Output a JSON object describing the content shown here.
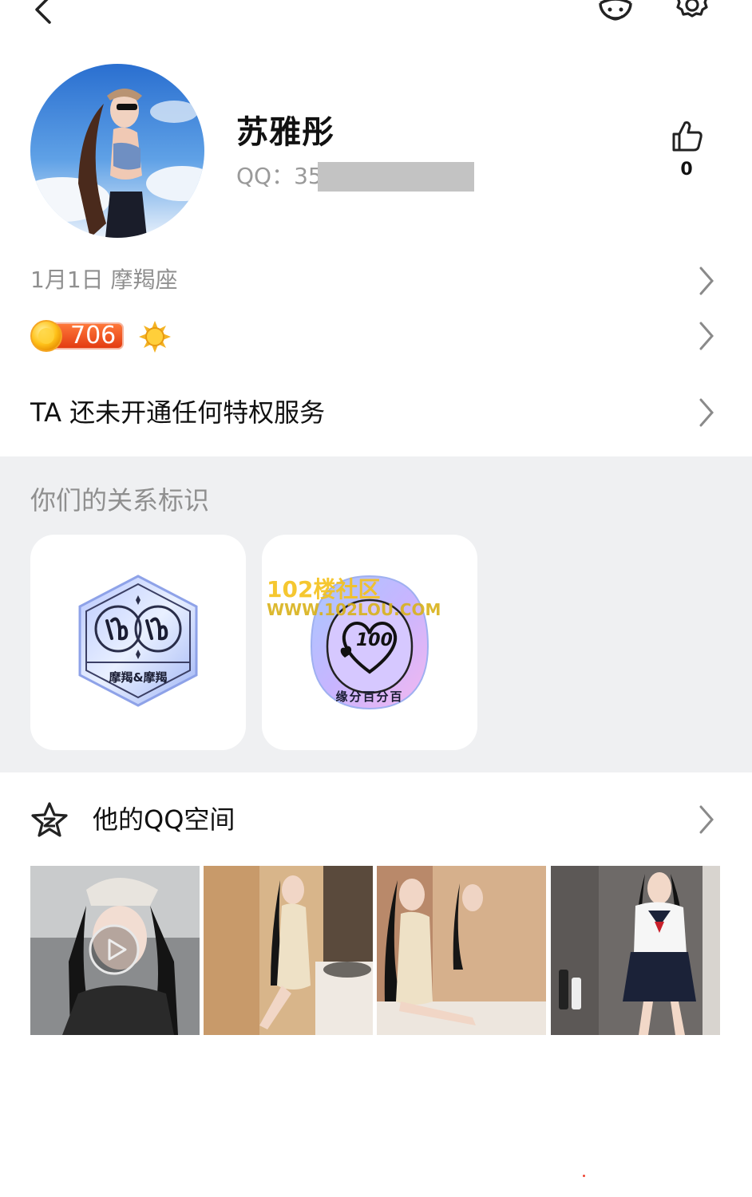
{
  "profile": {
    "name": "苏雅彤",
    "qq_label": "QQ：35",
    "like_count": "0"
  },
  "info": {
    "birthday": "1月1日  摩羯座",
    "level": "706",
    "privilege": "TA 还未开通任何特权服务"
  },
  "relationship": {
    "title": "你们的关系标识",
    "badges": [
      {
        "label": "摩羯&摩羯",
        "icon": "capricorn-badge-icon"
      },
      {
        "label": "缘分百分百",
        "score": "100",
        "icon": "heart-100-badge-icon"
      }
    ],
    "watermark_line1": "102楼社区",
    "watermark_line2": "WWW.102LOU.COM"
  },
  "qzone": {
    "title": "他的QQ空间",
    "photos": [
      {
        "kind": "video",
        "icon": "play-icon"
      },
      {
        "kind": "image"
      },
      {
        "kind": "image"
      },
      {
        "kind": "image"
      }
    ]
  },
  "icons": {
    "back": "back-arrow-icon",
    "emoji": "emoji-face-icon",
    "settings": "gear-icon",
    "like": "thumbs-up-icon",
    "chevron": "chevron-right-icon",
    "qzone": "qzone-star-icon",
    "sun": "sun-level-icon"
  },
  "colors": {
    "accent_orange": "#f04a1a",
    "section_gray": "#eff0f2",
    "muted_text": "#8f8f8f"
  }
}
